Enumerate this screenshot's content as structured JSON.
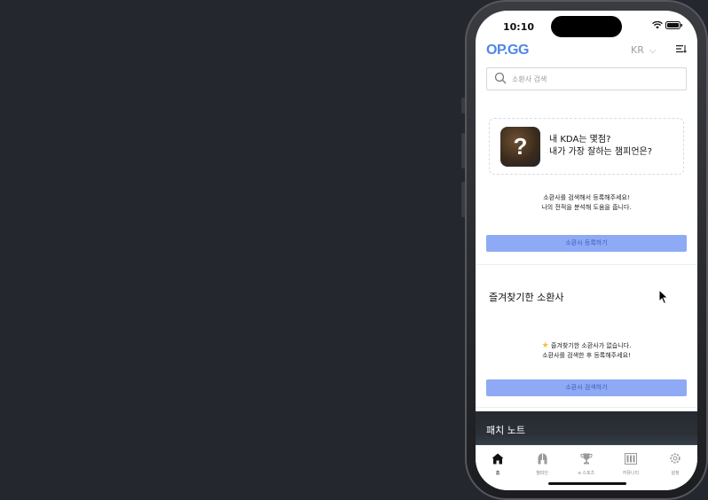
{
  "status_bar": {
    "time": "10:10"
  },
  "header": {
    "logo": "OP.GG",
    "region": "KR"
  },
  "search": {
    "placeholder": "소환사 검색"
  },
  "kda_card": {
    "line1": "내 KDA는 몇점?",
    "line2": "내가 가장 잘하는 챔피언은?"
  },
  "register": {
    "guide_line1": "소환사를 검색해서 등록해주세요!",
    "guide_line2": "나의 전적을 분석해 도움을 줍니다.",
    "button_label": "소환사 등록하기"
  },
  "favorites": {
    "title": "즐겨찾기한 소환사",
    "empty_line1": "즐겨찾기한 소환사가 없습니다.",
    "empty_line2": "소환사를 검색한 후 등록해주세요!",
    "button_label": "소환사 검색하기"
  },
  "patch_notes": {
    "title": "패치 노트"
  },
  "tab_bar": {
    "items": [
      {
        "label": "홈",
        "icon": "home-icon",
        "active": true
      },
      {
        "label": "챔피언",
        "icon": "helmet-icon",
        "active": false
      },
      {
        "label": "e 스포츠",
        "icon": "trophy-icon",
        "active": false
      },
      {
        "label": "커뮤니티",
        "icon": "community-icon",
        "active": false
      },
      {
        "label": "설정",
        "icon": "gear-icon",
        "active": false
      }
    ]
  },
  "colors": {
    "brand": "#4f86e6",
    "button": "#8eaaf4",
    "background": "#24272d"
  }
}
